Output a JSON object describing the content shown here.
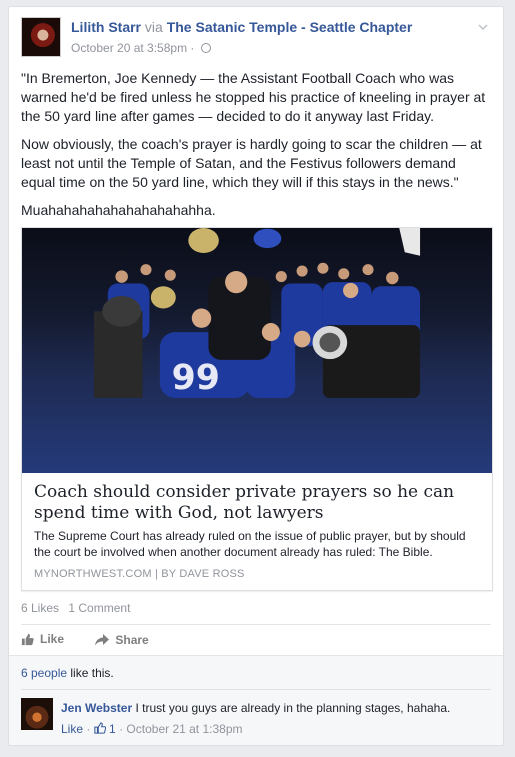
{
  "post": {
    "author": "Lilith Starr",
    "via_word": "via",
    "page": "The Satanic Temple - Seattle Chapter",
    "timestamp": "October 20 at 3:58pm",
    "separator": "·",
    "paragraphs": [
      "\"In Bremerton, Joe Kennedy — the Assistant Football Coach who was warned he'd be fired unless he stopped his practice of kneeling in prayer at the 50 yard line after games — decided to do it anyway last Friday.",
      "Now obviously, the coach's prayer is hardly going to scar the children — at least not until the Temple of Satan, and the Festivus followers demand equal time on the 50 yard line, which they will if this stays in the news.\"",
      "Muahahahahahahahahahahha."
    ]
  },
  "link_card": {
    "title": "Coach should consider private prayers so he can spend time with God, not lawyers",
    "description": "The Supreme Court has already ruled on the issue of public prayer, but by should the court be involved when another document already has ruled: The Bible.",
    "source": "MYNORTHWEST.COM | BY DAVE ROSS",
    "jersey_number": "99"
  },
  "stats": {
    "likes": "6 Likes",
    "comments": "1 Comment"
  },
  "actions": {
    "like": "Like",
    "share": "Share"
  },
  "comments_section": {
    "likers_link": "6 people",
    "likers_suffix": "like this."
  },
  "comment": {
    "author": "Jen Webster",
    "text": "I trust you guys are already in the planning stages, hahaha.",
    "like_link": "Like",
    "like_count": "1",
    "timestamp": "October 21 at 1:38pm"
  },
  "colors": {
    "link": "#365899",
    "muted": "#90949c",
    "text": "#1d2129",
    "jersey_blue": "#1f3a9e"
  }
}
